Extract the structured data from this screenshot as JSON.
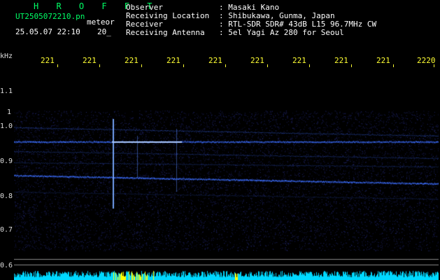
{
  "header": {
    "title": "H R O F F T",
    "filename": "UT2505072210.pn",
    "tag": "meteor",
    "datetime": "25.05.07 22:10",
    "page": "20_",
    "observer_label": "Observer",
    "observer_value": ": Masaki Kano",
    "location_label": "Receiving Location",
    "location_value": ": Shibukawa, Gunma, Japan",
    "receiver_label": "Receiver",
    "receiver_value": ": RTL-SDR SDR# 43dB L15 96.7MHz CW",
    "antenna_label": "Receiving Antenna",
    "antenna_value": ": 5el Yagi Az 280 for Seoul"
  },
  "axes": {
    "y_unit": "kHz",
    "y_ticks": [
      "1.1",
      "1",
      "1.0",
      "0.9",
      "0.8",
      "0.7",
      "0.6"
    ],
    "x_ticks": [
      "221",
      "221",
      "221",
      "221",
      "221",
      "221",
      "221",
      "221",
      "221",
      "2220"
    ]
  },
  "colors": {
    "background": "#000000",
    "text": "#ffffff",
    "title": "#00ff66",
    "time_ticks": "#ffff33",
    "signal": "#3a6bff",
    "bar_low": "#00d8ff",
    "bar_high": "#ffff00"
  }
}
